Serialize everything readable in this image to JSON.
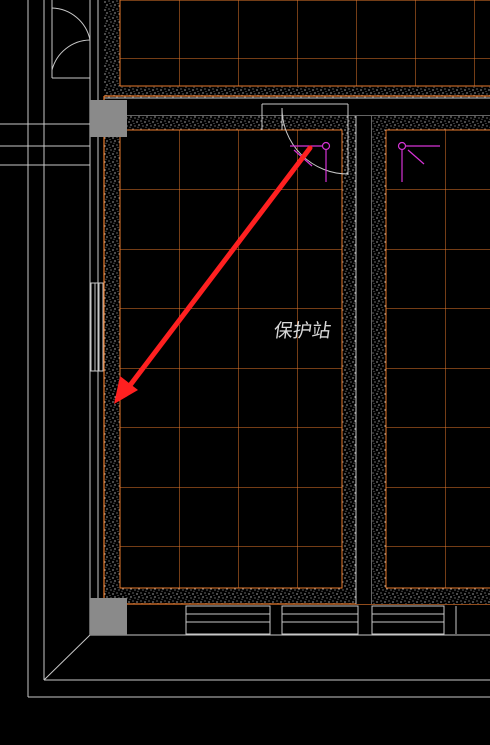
{
  "drawing": {
    "room_label": "保护站",
    "colors": {
      "background": "#000000",
      "wall_line": "#c8c8c8",
      "tile_grid": "#e87a2c",
      "fill_hatch": "#ffffff",
      "column": "#8a8a8a",
      "symbol": "#d633d6",
      "arrow": "#ff2020"
    }
  }
}
